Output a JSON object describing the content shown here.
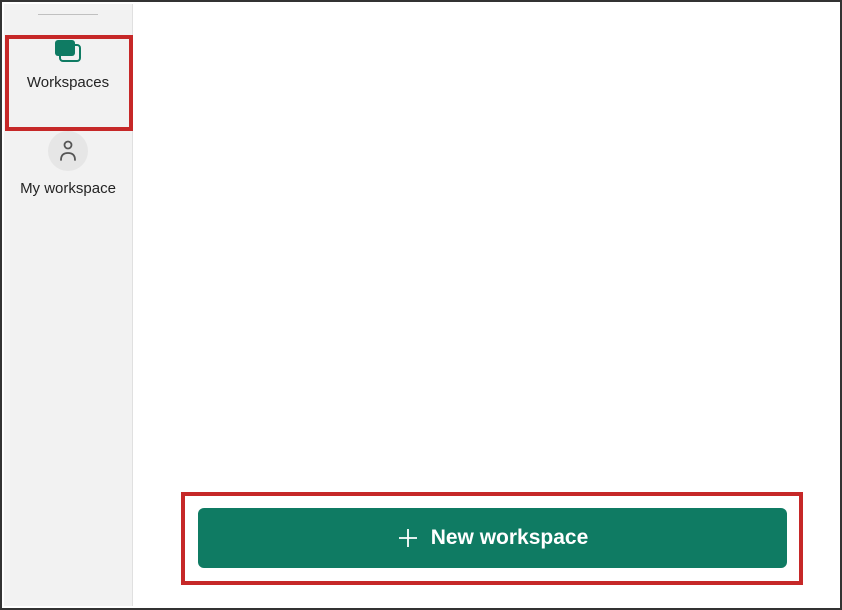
{
  "sidebar": {
    "items": [
      {
        "label": "Workspaces",
        "icon": "workspaces-icon"
      },
      {
        "label": "My workspace",
        "icon": "person-icon"
      }
    ]
  },
  "main": {
    "new_workspace_label": "New workspace"
  },
  "colors": {
    "accent": "#0f7b63",
    "highlight": "#c62828",
    "sidebar_bg": "#f2f2f2"
  }
}
